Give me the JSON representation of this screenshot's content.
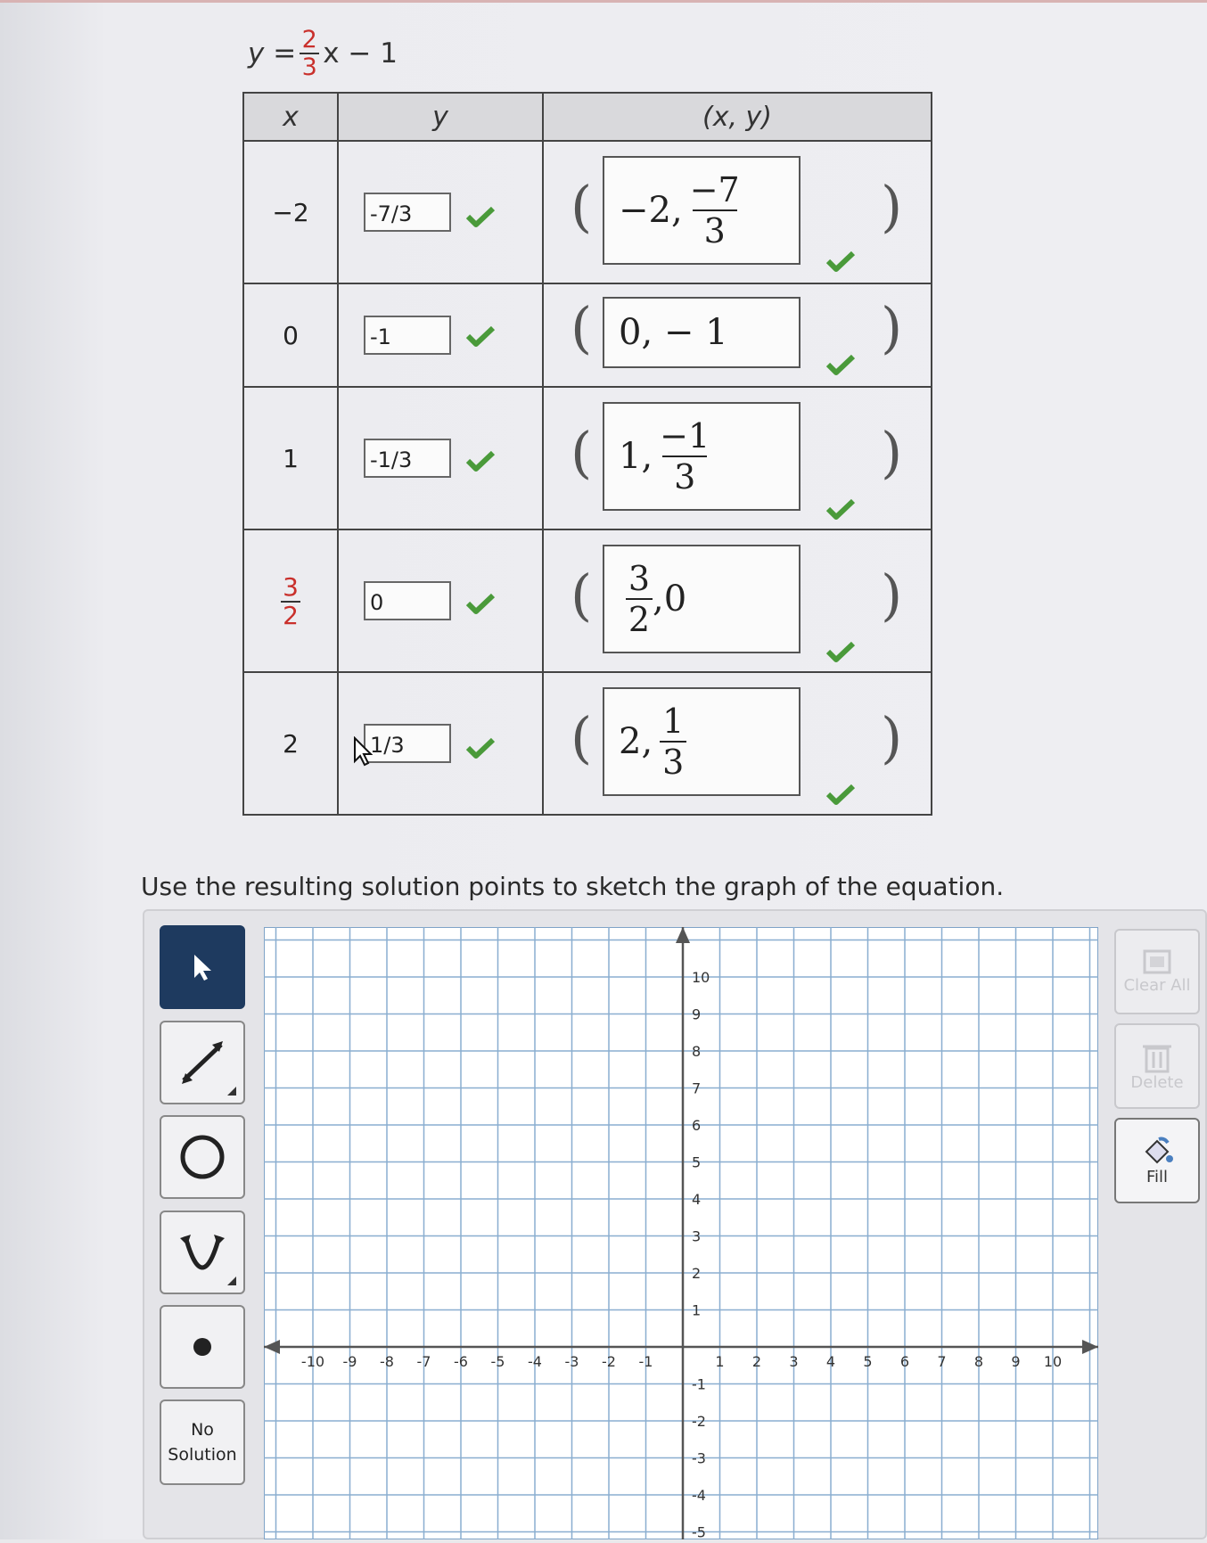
{
  "equation": {
    "lhs": "y =",
    "num": "2",
    "den": "3",
    "rest": "x − 1"
  },
  "table": {
    "headers": [
      "x",
      "y",
      "(x, y)"
    ],
    "rows": [
      {
        "x": "−2",
        "y": "-7/3",
        "pt_int": "−2,",
        "pt_num": "−7",
        "pt_den": "3"
      },
      {
        "x": "0",
        "y": "-1",
        "pt_text": "0, − 1"
      },
      {
        "x": "1",
        "y": "-1/3",
        "pt_int": "1,",
        "pt_num": "−1",
        "pt_den": "3"
      },
      {
        "x_num": "3",
        "x_den": "2",
        "y": "0",
        "pt_num": "3",
        "pt_den": "2",
        "pt_tail": ",0"
      },
      {
        "x": "2",
        "y": "1/3",
        "pt_int": "2,",
        "pt_num": "1",
        "pt_den": "3"
      }
    ]
  },
  "instruction": "Use the resulting solution points to sketch the graph of the equation.",
  "tools": {
    "no_solution_l1": "No",
    "no_solution_l2": "Solution"
  },
  "right_buttons": {
    "clear_all": "Clear All",
    "delete": "Delete",
    "fill": "Fill"
  },
  "graph": {
    "x_ticks": [
      "-10",
      "-9",
      "-8",
      "-7",
      "-6",
      "-5",
      "-4",
      "-3",
      "-2",
      "-1",
      "1",
      "2",
      "3",
      "4",
      "5",
      "6",
      "7",
      "8",
      "9",
      "10"
    ],
    "y_ticks_pos": [
      "10",
      "9",
      "8",
      "7",
      "6",
      "5",
      "4",
      "3",
      "2",
      "1"
    ],
    "y_ticks_neg": [
      "-1",
      "-2",
      "-3",
      "-4",
      "-5"
    ]
  },
  "colors": {
    "check": "#4a9a3a",
    "accent_red": "#c9302c",
    "active_tool": "#1e3a5f",
    "grid": "#8aaed0"
  }
}
